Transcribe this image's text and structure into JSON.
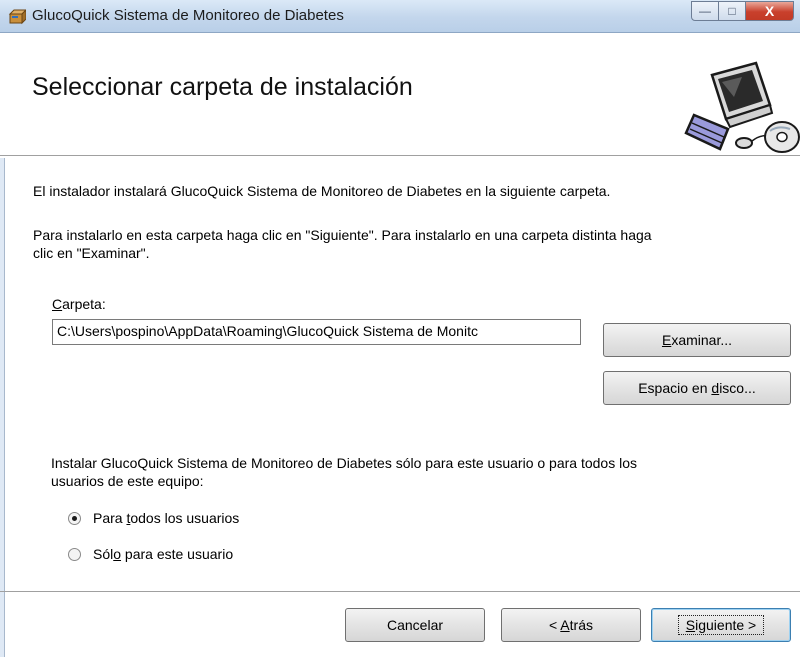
{
  "window": {
    "title": "GlucoQuick Sistema de Monitoreo de Diabetes",
    "controls": {
      "minimize": "—",
      "maximize": "□",
      "close": "X"
    }
  },
  "header": {
    "title": "Seleccionar carpeta de instalación"
  },
  "body": {
    "intro": "El instalador instalará GlucoQuick Sistema de Monitoreo de Diabetes en la siguiente carpeta.",
    "instructions_line1": "Para instalarlo en esta carpeta haga clic en \"Siguiente\". Para instalarlo en una carpeta distinta haga",
    "instructions_line2": "clic en \"Examinar\".",
    "folder_label_accel": "C",
    "folder_label_rest": "arpeta:",
    "folder_path": "C:\\Users\\pospino\\AppData\\Roaming\\GlucoQuick Sistema de Monitc",
    "browse_accel": "E",
    "browse_rest": "xaminar...",
    "disk_pre": "Espacio en ",
    "disk_accel": "d",
    "disk_post": "isco...",
    "install_for_line1": "Instalar GlucoQuick Sistema de Monitoreo de Diabetes sólo para este usuario o para todos los",
    "install_for_line2": "usuarios de este equipo:",
    "radio_all_pre": "Para ",
    "radio_all_accel": "t",
    "radio_all_post": "odos los usuarios",
    "radio_me_pre": "Sól",
    "radio_me_accel": "o",
    "radio_me_post": " para este usuario",
    "selected_option": "Para todos los usuarios"
  },
  "footer": {
    "cancel": "Cancelar",
    "back_pre": "< ",
    "back_accel": "A",
    "back_post": "trás",
    "next_accel": "S",
    "next_post": "iguiente >"
  },
  "icons": {
    "app": "installer-box-icon",
    "header_art": "computer-cd-icon"
  }
}
